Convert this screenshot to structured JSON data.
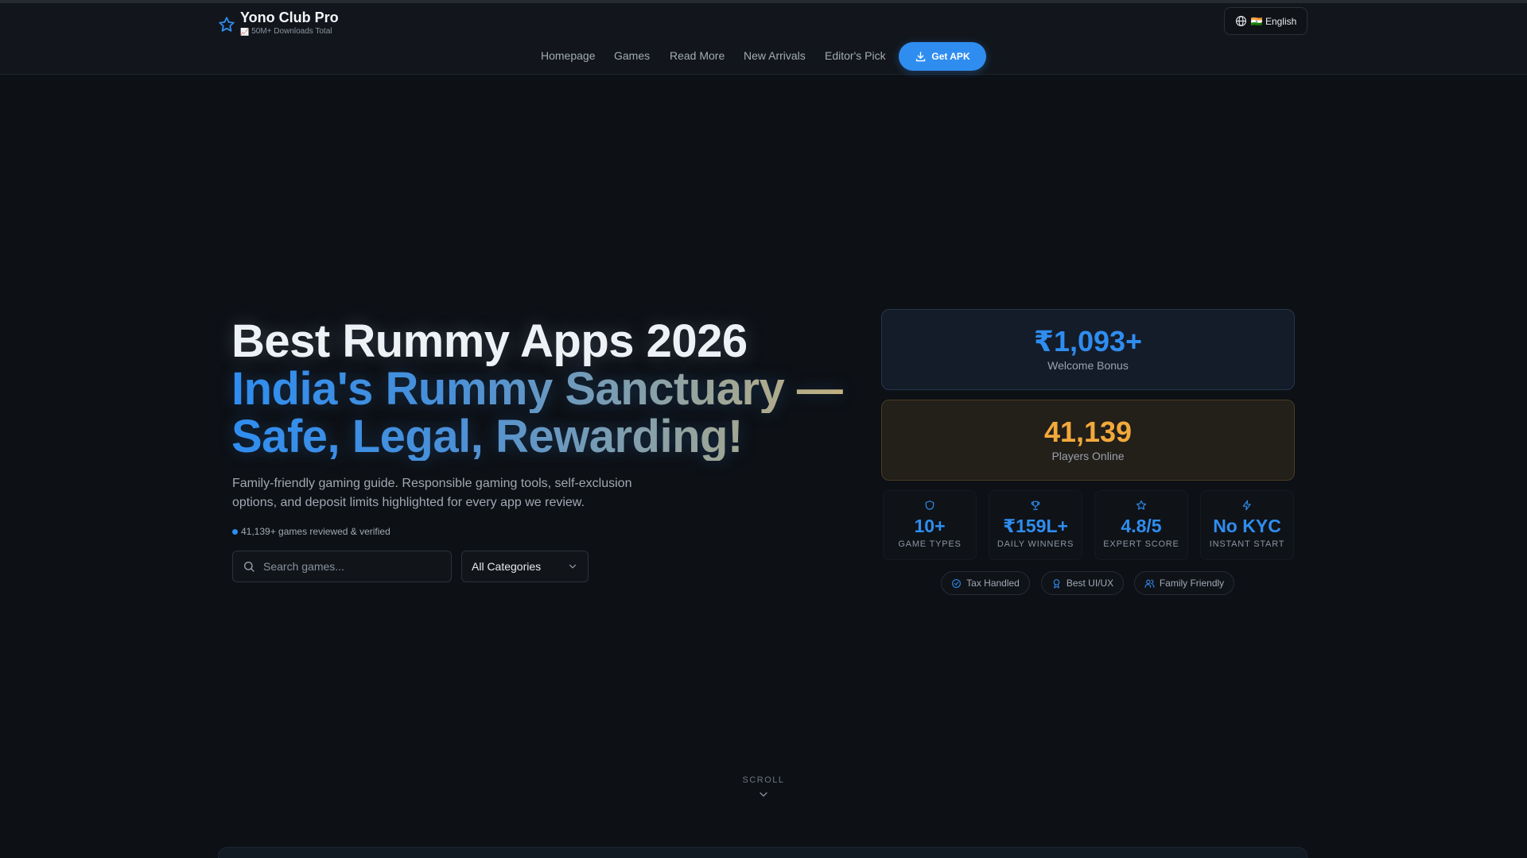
{
  "header": {
    "brand_title": "Yono Club Pro",
    "brand_subtitle": "50M+ Downloads Total",
    "language_label": "🇮🇳 English"
  },
  "nav": {
    "items": [
      "Homepage",
      "Games",
      "Read More",
      "New Arrivals",
      "Editor's Pick"
    ],
    "cta_label": "Get APK"
  },
  "hero": {
    "title_line1": "Best Rummy Apps 2026",
    "title_line2a": "India's Rummy Sanctuary —",
    "title_line2b": "Safe, Legal, Rewarding!",
    "description": "Family-friendly gaming guide. Responsible gaming tools, self-exclusion options, and deposit limits highlighted for every app we review.",
    "verified_text": "41,139+ games reviewed & verified",
    "search_placeholder": "Search games...",
    "category_selected": "All Categories"
  },
  "cards": {
    "bonus": {
      "value": "₹1,093+",
      "label": "Welcome Bonus"
    },
    "players": {
      "value": "41,139",
      "label": "Players Online"
    }
  },
  "stats": [
    {
      "value": "10+",
      "label": "GAME TYPES",
      "icon": "shield-icon"
    },
    {
      "value": "₹159L+",
      "label": "DAILY WINNERS",
      "icon": "trophy-icon"
    },
    {
      "value": "4.8/5",
      "label": "EXPERT SCORE",
      "icon": "star-icon"
    },
    {
      "value": "No KYC",
      "label": "INSTANT START",
      "icon": "bolt-icon"
    }
  ],
  "badges": [
    {
      "label": "Tax Handled",
      "icon": "check-circle-icon"
    },
    {
      "label": "Best UI/UX",
      "icon": "award-icon"
    },
    {
      "label": "Family Friendly",
      "icon": "users-icon"
    }
  ],
  "scroll_label": "SCROLL",
  "colors": {
    "accent": "#2f8df0",
    "players_accent": "#f2a93b",
    "background": "#0d1015"
  }
}
